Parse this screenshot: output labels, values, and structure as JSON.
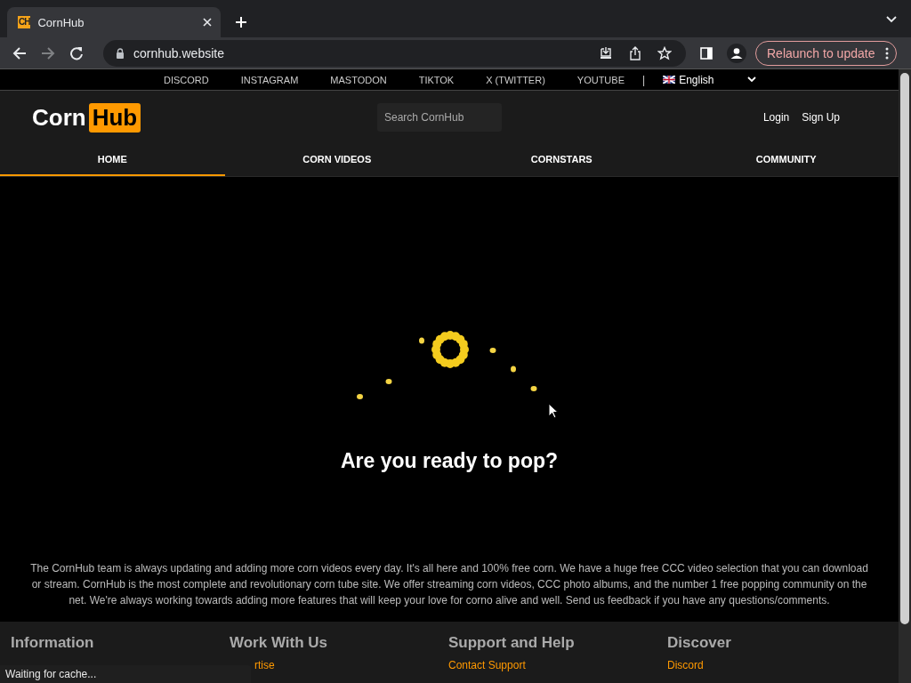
{
  "browser": {
    "tab": {
      "title": "CornHub",
      "favicon": "CH"
    },
    "address": "cornhub.website",
    "update_button": "Relaunch to update"
  },
  "social_links": [
    "DISCORD",
    "INSTAGRAM",
    "MASTODON",
    "TIKTOK",
    "X (TWITTER)",
    "YOUTUBE"
  ],
  "separator": "|",
  "language": {
    "label": "English"
  },
  "logo": {
    "text": "Corn",
    "badge": "Hub"
  },
  "search": {
    "placeholder": "Search CornHub"
  },
  "account_links": [
    "Login",
    "Sign Up"
  ],
  "nav_tabs": [
    {
      "label": "HOME",
      "selected": true
    },
    {
      "label": "CORN VIDEOS",
      "selected": false
    },
    {
      "label": "CORNSTARS",
      "selected": false
    },
    {
      "label": "COMMUNITY",
      "selected": false
    }
  ],
  "headline": "Are you ready to pop?",
  "description": "The CornHub team is always updating and adding more corn videos every day. It's all here and 100% free corn. We have a huge free CCC video selection that you can download or stream. CornHub is the most complete and revolutionary corn tube site. We offer streaming corn videos, CCC photo albums, and the number 1 free popping community on the net. We're always working towards adding more features that will keep your love for corno alive and well. Send us feedback if you have any questions/comments.",
  "footer_columns": [
    {
      "title": "Information"
    },
    {
      "title": "Work With Us",
      "link": "rtise"
    },
    {
      "title": "Support and Help",
      "link": "Contact Support"
    },
    {
      "title": "Discover",
      "link": "Discord"
    }
  ],
  "status_bar": "Waiting for cache..."
}
